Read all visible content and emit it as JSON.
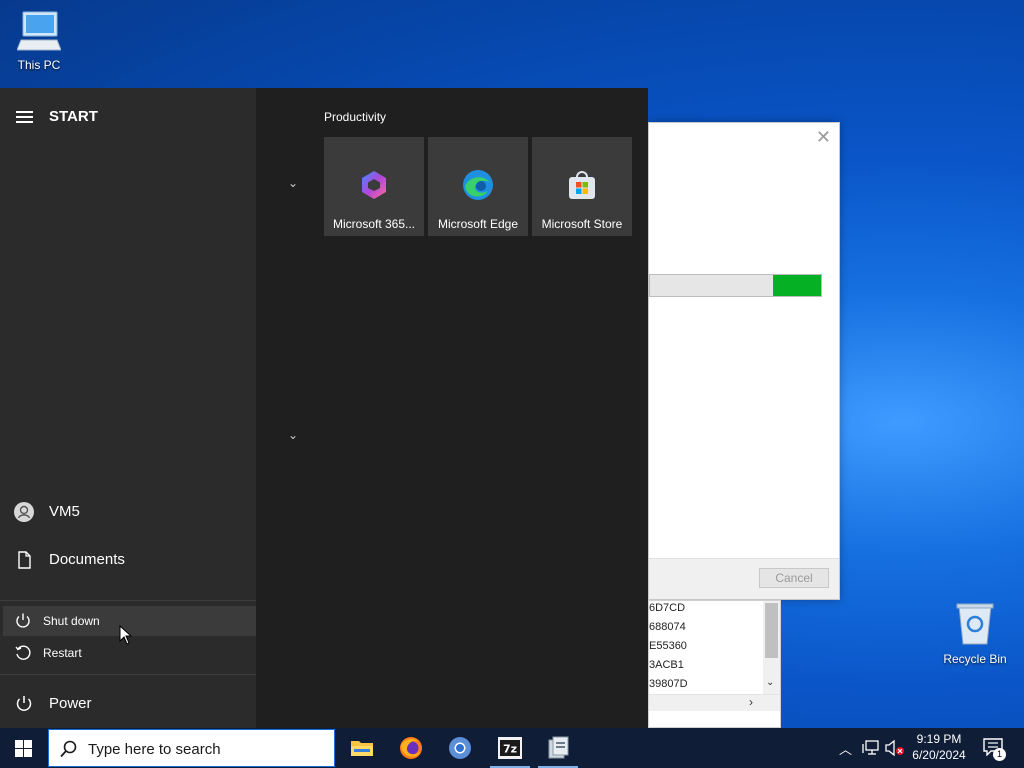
{
  "desktop": {
    "icons": [
      {
        "label": "This PC",
        "icon": "computer-icon"
      },
      {
        "label": "Recycle Bin",
        "icon": "recycle-bin-icon"
      }
    ]
  },
  "background_dialog": {
    "cancel_label": "Cancel",
    "progress_fraction": 0.28,
    "accent": "#06b025"
  },
  "background_list": {
    "rows": [
      "6D7CD",
      "688074",
      "E55360",
      "3ACB1",
      "39807D"
    ]
  },
  "start_menu": {
    "title": "START",
    "group_title": "Productivity",
    "tiles": [
      {
        "label": "Microsoft 365...",
        "icon": "microsoft-365-icon"
      },
      {
        "label": "Microsoft Edge",
        "icon": "edge-icon"
      },
      {
        "label": "Microsoft Store",
        "icon": "store-icon"
      }
    ],
    "user": {
      "name": "VM5"
    },
    "documents_label": "Documents",
    "power_options": [
      {
        "label": "Shut down",
        "icon": "power-icon"
      },
      {
        "label": "Restart",
        "icon": "restart-icon"
      }
    ],
    "power_label": "Power"
  },
  "taskbar": {
    "search_placeholder": "Type here to search",
    "apps": [
      "file-explorer-icon",
      "firefox-icon",
      "chrome-icon",
      "7zip-icon",
      "installer-icon"
    ],
    "tray": {
      "time": "9:19 PM",
      "date": "6/20/2024",
      "notification_count": "1"
    }
  },
  "colors": {
    "start_left_bg": "#2b2b2b",
    "start_right_bg": "#1f1f1f",
    "taskbar_bg": "#0f1d36"
  }
}
